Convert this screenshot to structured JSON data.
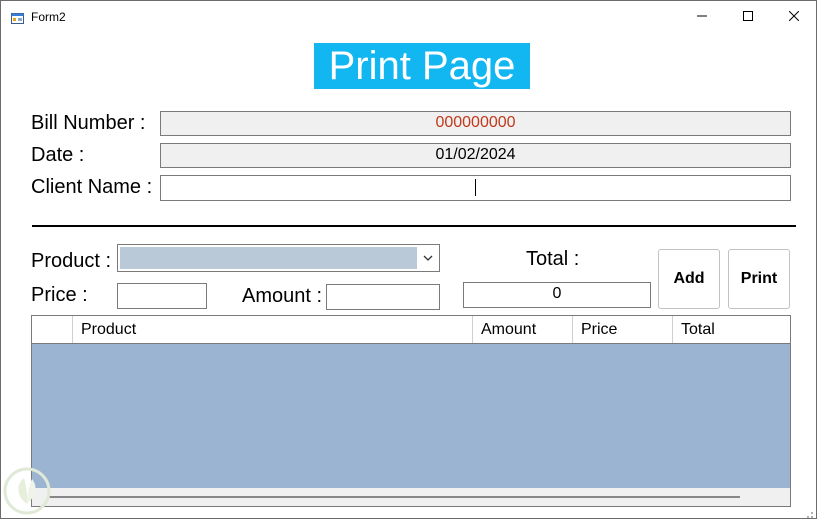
{
  "window": {
    "title": "Form2",
    "icon": "form-app-icon",
    "controls": {
      "minimize": "minimize-icon",
      "maximize": "maximize-icon",
      "close": "close-icon"
    }
  },
  "heading": "Print Page",
  "form": {
    "bill_number_label": "Bill Number :",
    "bill_number_value": "000000000",
    "date_label": "Date :",
    "date_value": "01/02/2024",
    "client_name_label": "Client Name :",
    "client_name_value": ""
  },
  "entry": {
    "product_label": "Product :",
    "product_selected": "",
    "price_label": "Price :",
    "price_value": "",
    "amount_label": "Amount :",
    "amount_value": "",
    "total_label": "Total :",
    "total_value": "0",
    "add_button": "Add",
    "print_button": "Print"
  },
  "grid": {
    "columns": [
      "Product",
      "Amount",
      "Price",
      "Total"
    ],
    "rows": []
  },
  "colors": {
    "heading_bg": "#12b6f1",
    "bill_number_text": "#c0391b",
    "grid_background": "#9bb4d1",
    "combo_selection": "#bac9d8",
    "readonly_field": "#f0f0f0"
  }
}
